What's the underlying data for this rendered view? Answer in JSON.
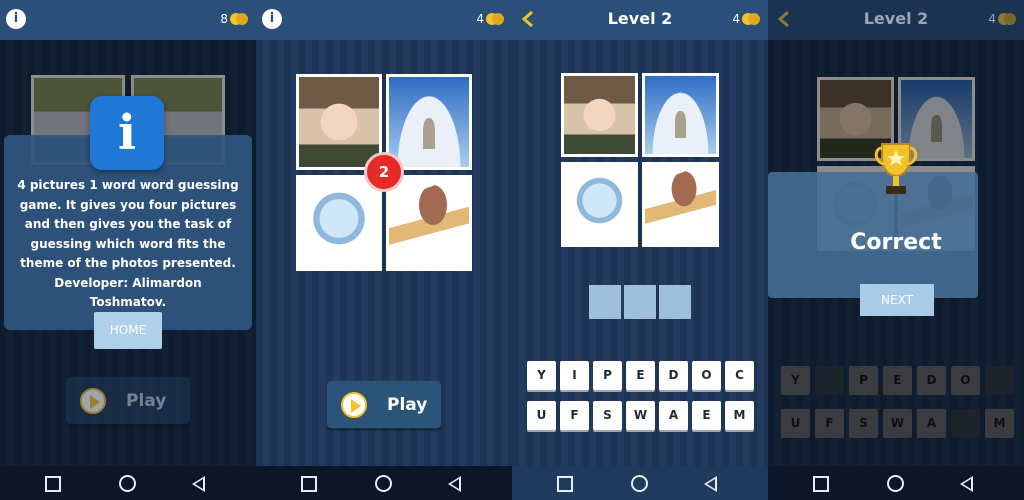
{
  "panel1": {
    "coins": "8",
    "info_text": "4 pictures 1 word word guessing game. It gives you four pictures and then gives you the task of guessing which word fits the theme of the photos presented. Developer: Alimardon Toshmatov.",
    "home_label": "HOME",
    "play_label": "Play"
  },
  "panel2": {
    "coins": "4",
    "level_badge": "2",
    "play_label": "Play"
  },
  "panel3": {
    "title": "Level 2",
    "coins": "4",
    "keys_row1": [
      "Y",
      "I",
      "P",
      "E",
      "D",
      "O",
      "C"
    ],
    "keys_row2": [
      "U",
      "F",
      "S",
      "W",
      "A",
      "E",
      "M"
    ]
  },
  "panel4": {
    "title": "Level 2",
    "coins": "4",
    "correct_label": "Correct",
    "next_label": "NEXT",
    "keys_row1": [
      "Y",
      "",
      "P",
      "E",
      "D",
      "O",
      ""
    ],
    "keys_row2": [
      "U",
      "F",
      "S",
      "W",
      "A",
      "",
      "M"
    ]
  },
  "colors": {
    "topbar": "#2a4f78",
    "accent_gold": "#f2c12c",
    "badge_red": "#e62a2a",
    "slot_blue": "#9fc0dc"
  }
}
